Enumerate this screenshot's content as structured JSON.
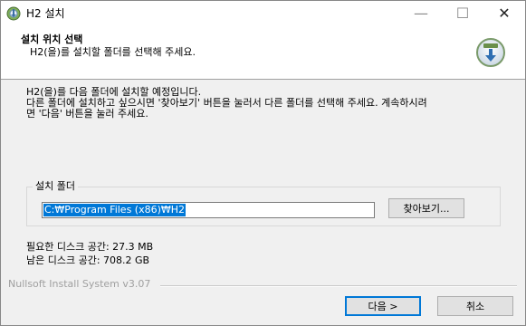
{
  "window": {
    "title": "H2 설치",
    "minimize_glyph": "—",
    "maximize_glyph": "☐",
    "close_glyph": "✕"
  },
  "header": {
    "title": "설치 위치 선택",
    "subtitle": "H2(을)를 설치할 폴더를 선택해 주세요."
  },
  "body": {
    "line1": "H2(을)를 다음 폴더에 설치할 예정입니다.",
    "line2": "다른 폴더에 설치하고 싶으시면 '찾아보기' 버튼을 눌러서 다른 폴더를 선택해 주세요. 계속하시려",
    "line3": "면 '다음' 버튼을 눌러 주세요."
  },
  "destination": {
    "group_label": "설치 폴더",
    "path_value": "C:₩Program Files (x86)₩H2",
    "browse_label": "찾아보기..."
  },
  "space": {
    "required": "필요한 디스크 공간: 27.3 MB",
    "available": "남은 디스크 공간: 708.2 GB"
  },
  "footer": {
    "branding": "Nullsoft Install System v3.07",
    "next_label": "다음 >",
    "cancel_label": "취소"
  },
  "colors": {
    "accent": "#0078d7",
    "selection": "#0078d7"
  },
  "icons": {
    "app": "installer-icon",
    "header": "nsis-logo-icon"
  }
}
